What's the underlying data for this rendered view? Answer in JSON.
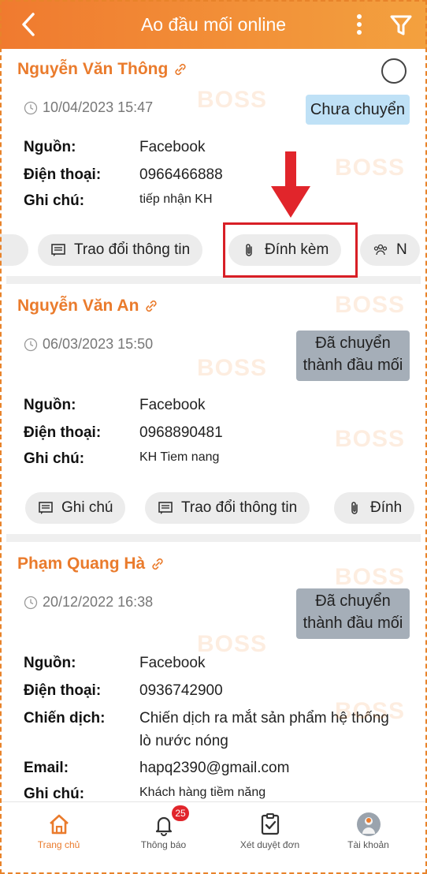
{
  "header": {
    "title": "Ao đầu mối online"
  },
  "watermark_text": "BOSS",
  "cards": [
    {
      "name": "Nguyễn Văn Thông",
      "datetime": "10/04/2023 15:47",
      "status": "Chưa chuyển",
      "fields": [
        {
          "label": "Nguồn:",
          "value": "Facebook"
        },
        {
          "label": "Điện thoại:",
          "value": "0966466888"
        },
        {
          "label": "Ghi chú:",
          "value": "tiếp nhận KH"
        }
      ],
      "actions": [
        "Trao đổi thông tin",
        "Đính kèm",
        "N"
      ]
    },
    {
      "name": "Nguyễn Văn An",
      "datetime": "06/03/2023 15:50",
      "status_line1": "Đã chuyển",
      "status_line2": "thành đầu mối",
      "fields": [
        {
          "label": "Nguồn:",
          "value": "Facebook"
        },
        {
          "label": "Điện thoại:",
          "value": "0968890481"
        },
        {
          "label": "Ghi chú:",
          "value": "KH Tiem nang"
        }
      ],
      "actions": [
        "Ghi chú",
        "Trao đổi thông tin",
        "Đính"
      ]
    },
    {
      "name": "Phạm Quang Hà",
      "datetime": "20/12/2022 16:38",
      "status_line1": "Đã chuyển",
      "status_line2": "thành đầu mối",
      "fields": [
        {
          "label": "Nguồn:",
          "value": "Facebook"
        },
        {
          "label": "Điện thoại:",
          "value": "0936742900"
        },
        {
          "label": "Chiến dịch:",
          "value": "Chiến dịch ra mắt sản phẩm hệ thống",
          "value2": "lò nước nóng"
        },
        {
          "label": "Email:",
          "value": "hapq2390@gmail.com"
        },
        {
          "label": "Ghi chú:",
          "value": "Khách hàng tiềm năng"
        }
      ]
    }
  ],
  "tabbar": {
    "items": [
      {
        "label": "Trang chủ",
        "icon": "home-icon"
      },
      {
        "label": "Thông báo",
        "icon": "bell-icon",
        "badge": "25"
      },
      {
        "label": "Xét duyệt đơn",
        "icon": "clipboard-check-icon"
      },
      {
        "label": "Tài khoản",
        "icon": "avatar-icon"
      }
    ]
  },
  "colors": {
    "accent": "#ea7b2c",
    "highlight": "#d81f26",
    "badge_new": "#bfe1f6",
    "badge_done": "#a5aeb8"
  }
}
